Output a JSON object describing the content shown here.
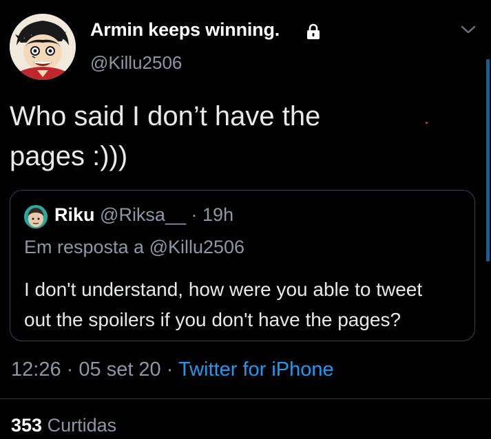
{
  "author": {
    "display_name": "Armin keeps winning.",
    "handle": "@Killu2506",
    "avatar": "anime-character-avatar",
    "protected_icon": "lock-icon"
  },
  "tweet": {
    "text_line1": "Who said I don’t have the",
    "text_line2": "pages :)))"
  },
  "quote": {
    "name": "Riku",
    "handle": "@Riksa__",
    "separator": "·",
    "age": "19h",
    "reply_to": "Em resposta a @Killu2506",
    "text_line1": "I don't understand, how were you able to tweet",
    "text_line2": "out the spoilers if you don't have the pages?",
    "avatar": "cartoon-avatar"
  },
  "meta": {
    "time": "12:26",
    "sep1": "·",
    "date": "05 set 20",
    "sep2": "·",
    "source": "Twitter for iPhone"
  },
  "stats": {
    "likes_count": "353",
    "likes_label": "Curtidas"
  },
  "colors": {
    "background": "#000000",
    "primary_text": "#e7e9ea",
    "secondary_text": "#8b98a5",
    "link": "#1d9bf0",
    "border": "#38444d"
  }
}
